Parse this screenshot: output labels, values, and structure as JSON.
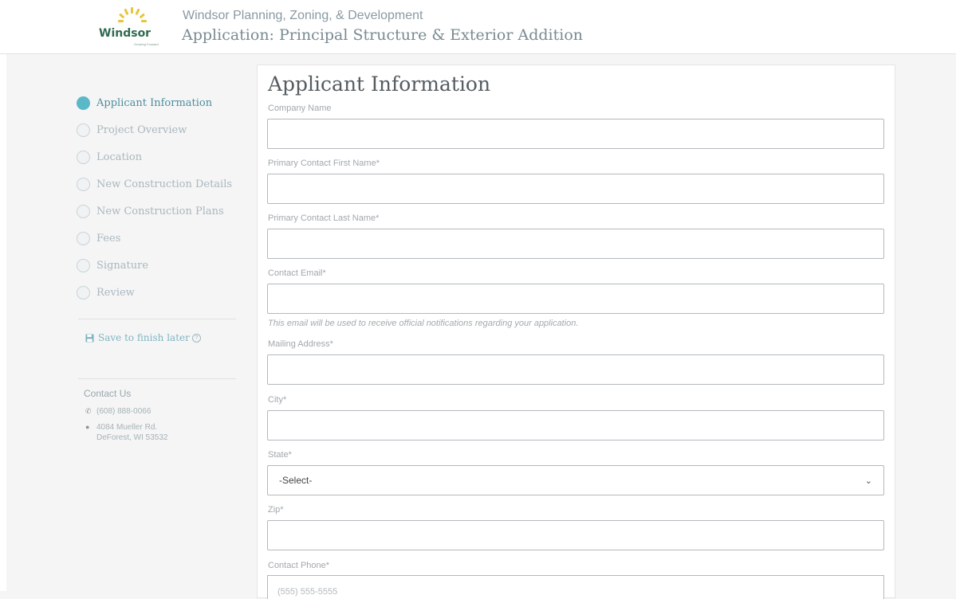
{
  "header": {
    "logo_text": "Windsor",
    "logo_tagline": "Growing Forward",
    "subtitle": "Windsor Planning, Zoning, & Development",
    "title": "Application: Principal Structure & Exterior Addition"
  },
  "colors": {
    "accent": "#5bb8c9",
    "logo_green": "#2e6b4f",
    "logo_sun": "#e8c53a"
  },
  "sidebar": {
    "steps": [
      {
        "label": "Applicant Information",
        "active": true
      },
      {
        "label": "Project Overview",
        "active": false
      },
      {
        "label": "Location",
        "active": false
      },
      {
        "label": "New Construction Details",
        "active": false
      },
      {
        "label": "New Construction Plans",
        "active": false
      },
      {
        "label": "Fees",
        "active": false
      },
      {
        "label": "Signature",
        "active": false
      },
      {
        "label": "Review",
        "active": false
      }
    ],
    "save_later": "Save to finish later",
    "contact": {
      "title": "Contact Us",
      "phone": "(608) 888-0066",
      "address_line1": "4084 Mueller Rd.",
      "address_line2": "DeForest, WI 53532"
    }
  },
  "form": {
    "title": "Applicant Information",
    "company_label": "Company Name",
    "first_name_label": "Primary Contact First Name*",
    "last_name_label": "Primary Contact Last Name*",
    "email_label": "Contact Email*",
    "email_hint": "This email will be used to receive official notifications regarding your application.",
    "address_label": "Mailing Address*",
    "city_label": "City*",
    "state_label": "State*",
    "state_value": "-Select-",
    "zip_label": "Zip*",
    "phone_label": "Contact Phone*",
    "phone_placeholder": "(555) 555-5555"
  }
}
